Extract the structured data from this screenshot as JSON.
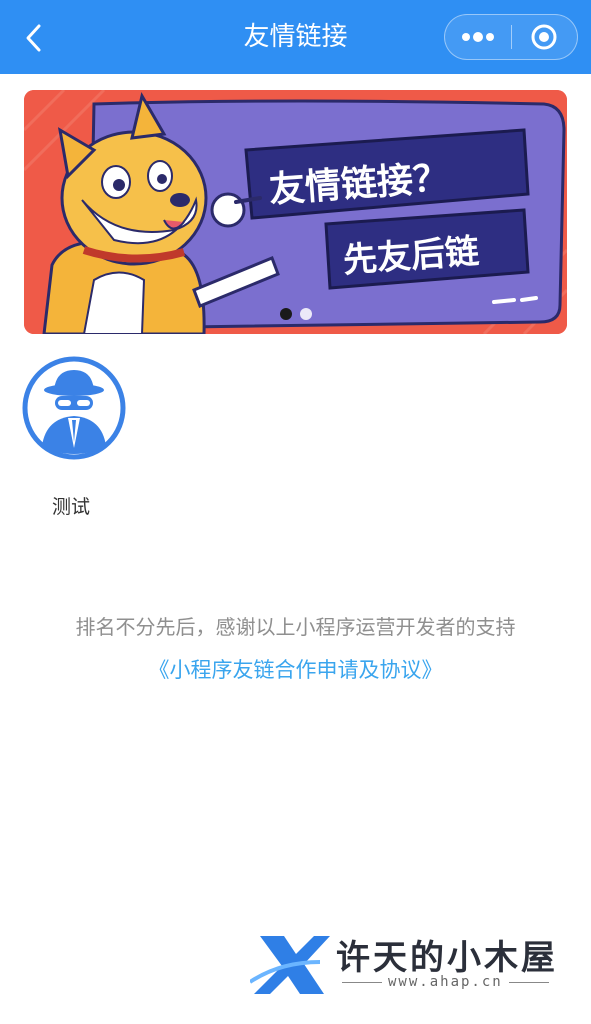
{
  "navbar": {
    "title": "友情链接",
    "back_icon": "chevron-left-icon",
    "menu_icon": "more-dots-icon",
    "close_icon": "target-circle-icon",
    "bg_color": "#2f8ff3"
  },
  "banner": {
    "headline": "友情链接？",
    "slogan": "先友后链",
    "slide_count": 2,
    "active_slide": 1
  },
  "friends": [
    {
      "name": "测试",
      "icon": "spy-avatar-icon"
    }
  ],
  "notice_text": "排名不分先后，感谢以上小程序运营开发者的支持",
  "agreement_link": "《小程序友链合作申请及协议》",
  "watermark": {
    "title": "许天的小木屋",
    "url": "www.ahap.cn"
  }
}
